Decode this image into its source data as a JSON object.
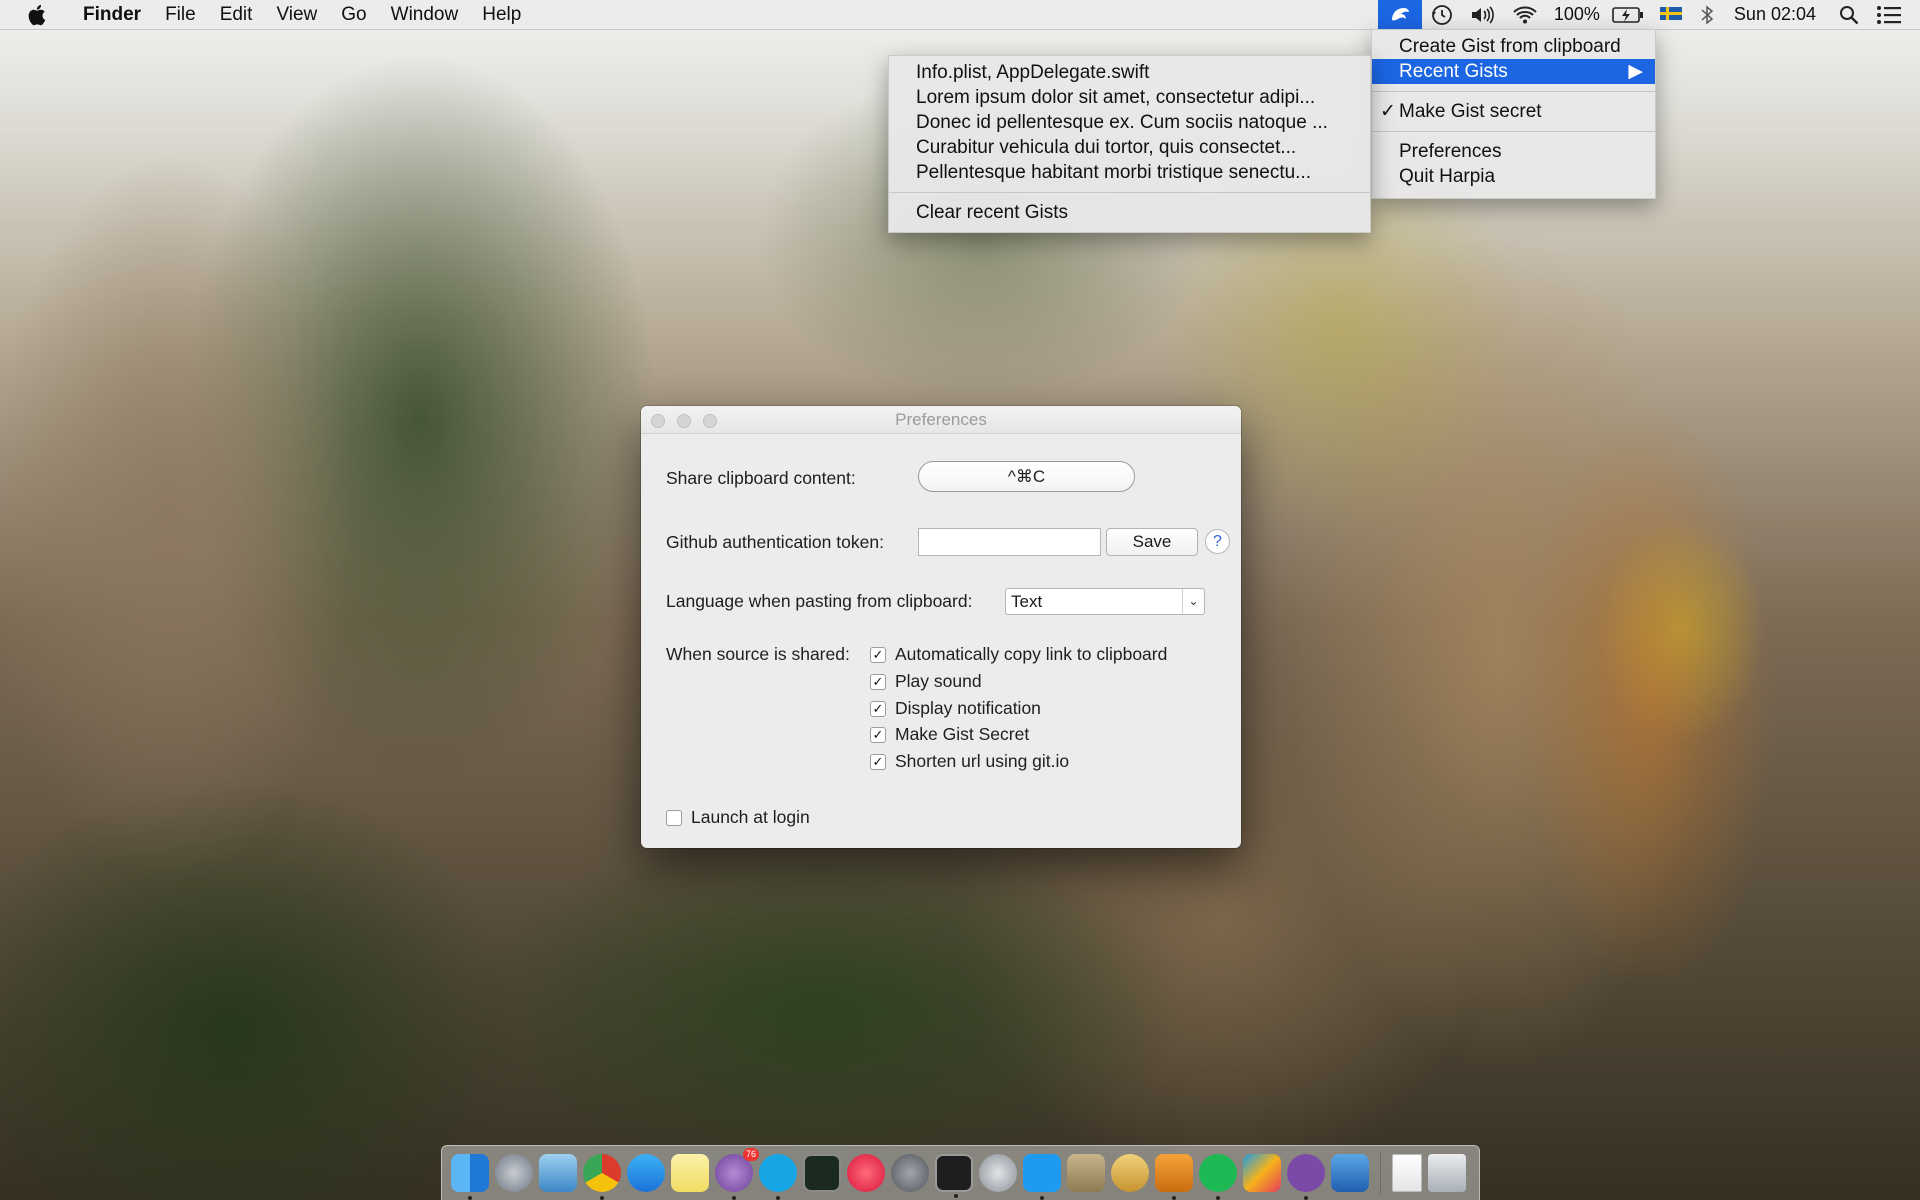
{
  "menubar": {
    "app_name": "Finder",
    "items": [
      "File",
      "Edit",
      "View",
      "Go",
      "Window",
      "Help"
    ],
    "battery": "100%",
    "clock": "Sun 02:04"
  },
  "harpia_menu": {
    "create_gist": "Create Gist from clipboard",
    "recent_gists": "Recent Gists",
    "make_secret": "Make Gist secret",
    "make_secret_checked": true,
    "check_mark": "✓",
    "submenu_arrow": "▶",
    "preferences": "Preferences",
    "quit": "Quit Harpia"
  },
  "recent_submenu": {
    "items": [
      "Info.plist, AppDelegate.swift",
      "Lorem ipsum dolor sit amet, consectetur adipi...",
      "Donec id pellentesque ex. Cum sociis natoque ...",
      "Curabitur vehicula dui tortor, quis consectet...",
      "Pellentesque habitant morbi tristique senectu..."
    ],
    "clear": "Clear recent Gists"
  },
  "preferences": {
    "title": "Preferences",
    "share_label": "Share clipboard content:",
    "shortcut": "^⌘C",
    "token_label": "Github authentication token:",
    "token_value": "",
    "save": "Save",
    "help": "?",
    "language_label": "Language when pasting from clipboard:",
    "language_value": "Text",
    "language_chevron": "⌄",
    "shared_label": "When source is shared:",
    "options": [
      {
        "label": "Automatically copy link to clipboard",
        "checked": true
      },
      {
        "label": "Play sound",
        "checked": true
      },
      {
        "label": "Display notification",
        "checked": true
      },
      {
        "label": "Make Gist Secret",
        "checked": true
      },
      {
        "label": "Shorten url using git.io",
        "checked": true
      }
    ],
    "launch_label": "Launch at login",
    "launch_checked": false
  },
  "dock": {
    "apps": [
      "finder-icon",
      "launchpad-icon",
      "preview-icon",
      "chrome-icon",
      "app-store-icon",
      "notes-icon",
      "tweetbot-icon",
      "skype-icon",
      "activity-monitor-icon",
      "itunes-icon",
      "system-preferences-icon",
      "terminal-icon",
      "disk-utility-icon",
      "twitter-icon",
      "archive-icon",
      "sequel-pro-icon",
      "sublime-text-icon",
      "spotify-icon",
      "intellij-icon",
      "github-icon",
      "xcode-icon"
    ],
    "badge": "76",
    "colors": {
      "accent": "#1c65e3"
    }
  }
}
